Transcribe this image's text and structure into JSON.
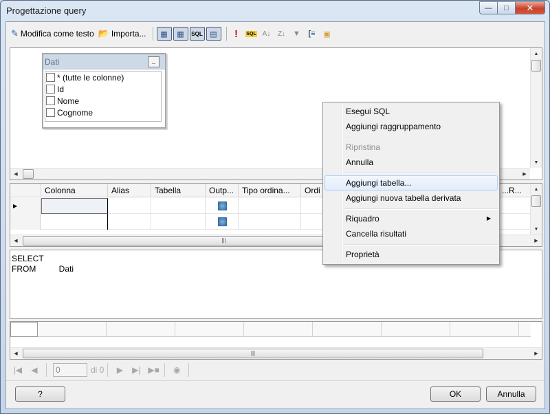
{
  "window": {
    "title": "Progettazione query"
  },
  "toolbar": {
    "edit_as_text_label": "Modifica come testo",
    "import_label": "Importa..."
  },
  "diagram": {
    "table_name": "Dati",
    "columns": [
      "* (tutte le colonne)",
      "Id",
      "Nome",
      "Cognome"
    ]
  },
  "grid": {
    "headers": [
      "Colonna",
      "Alias",
      "Tabella",
      "Outp...",
      "Tipo ordina...",
      "Ordi",
      "...R..."
    ]
  },
  "sql": {
    "line1": "SELECT",
    "line2": "FROM          Dati"
  },
  "navigator": {
    "record_value": "0",
    "of_label": "di 0"
  },
  "footer": {
    "help_label": "?",
    "ok_label": "OK",
    "cancel_label": "Annulla"
  },
  "context_menu": {
    "items": [
      {
        "label": "Esegui SQL",
        "enabled": true
      },
      {
        "label": "Aggiungi raggruppamento",
        "enabled": true
      },
      {
        "label": "Ripristina",
        "enabled": false
      },
      {
        "label": "Annulla",
        "enabled": true
      },
      {
        "label": "Aggiungi tabella...",
        "enabled": true,
        "highlighted": true
      },
      {
        "label": "Aggiungi nuova tabella derivata",
        "enabled": true
      },
      {
        "label": "Riquadro",
        "enabled": true,
        "submenu": true
      },
      {
        "label": "Cancella risultati",
        "enabled": true
      },
      {
        "label": "Proprietà",
        "enabled": true
      }
    ]
  }
}
